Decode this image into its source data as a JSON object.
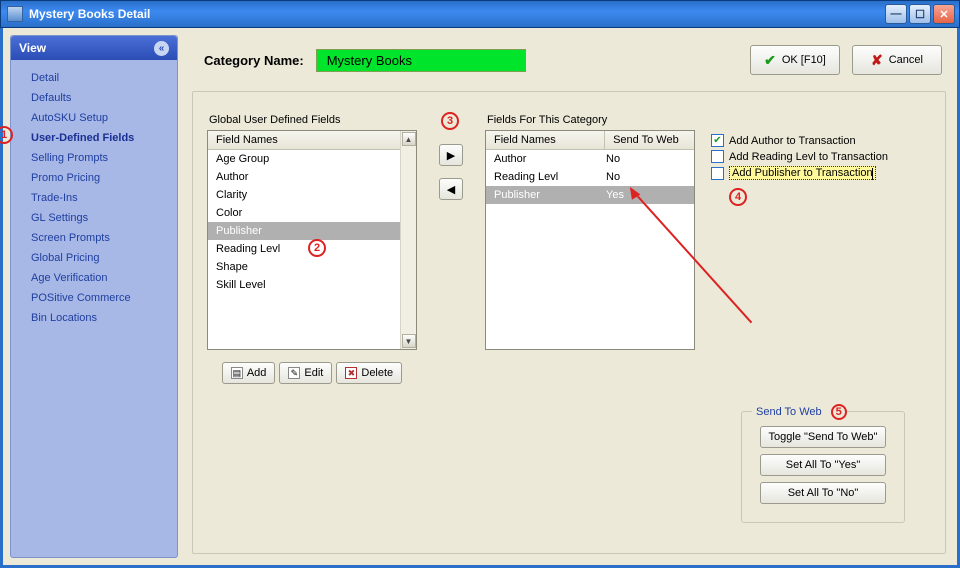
{
  "window": {
    "title": "Mystery Books Detail"
  },
  "sidebar": {
    "header": "View",
    "items": [
      {
        "label": "Detail"
      },
      {
        "label": "Defaults"
      },
      {
        "label": "AutoSKU Setup"
      },
      {
        "label": "User-Defined Fields"
      },
      {
        "label": "Selling Prompts"
      },
      {
        "label": "Promo Pricing"
      },
      {
        "label": "Trade-Ins"
      },
      {
        "label": "GL Settings"
      },
      {
        "label": "Screen Prompts"
      },
      {
        "label": "Global Pricing"
      },
      {
        "label": "Age Verification"
      },
      {
        "label": "POSitive Commerce"
      },
      {
        "label": "Bin Locations"
      }
    ],
    "active_index": 3
  },
  "header": {
    "category_label": "Category Name:",
    "category_value": "Mystery Books",
    "ok_label": "OK [F10]",
    "cancel_label": "Cancel"
  },
  "global_fields": {
    "title": "Global User Defined Fields",
    "column": "Field Names",
    "rows": [
      "Age Group",
      "Author",
      "Clarity",
      "Color",
      "Publisher",
      "Reading Levl",
      "Shape",
      "Skill Level"
    ],
    "selected_index": 4,
    "toolbar": {
      "add": "Add",
      "edit": "Edit",
      "delete": "Delete"
    }
  },
  "category_fields": {
    "title": "Fields For This Category",
    "columns": [
      "Field Names",
      "Send To Web"
    ],
    "rows": [
      {
        "name": "Author",
        "send": "No"
      },
      {
        "name": "Reading Levl",
        "send": "No"
      },
      {
        "name": "Publisher",
        "send": "Yes"
      }
    ],
    "selected_index": 2
  },
  "checkboxes": {
    "items": [
      {
        "label": "Add Author to Transaction",
        "checked": true,
        "highlight": false
      },
      {
        "label": "Add Reading Levl to Transaction",
        "checked": false,
        "highlight": false
      },
      {
        "label": "Add Publisher to Transaction",
        "checked": false,
        "highlight": true
      }
    ]
  },
  "send_to_web": {
    "title": "Send To Web",
    "toggle": "Toggle \"Send To Web\"",
    "yes": "Set All To \"Yes\"",
    "no": "Set All To \"No\""
  },
  "annotations": {
    "n1": "1",
    "n2": "2",
    "n3": "3",
    "n4": "4",
    "n5": "5"
  }
}
